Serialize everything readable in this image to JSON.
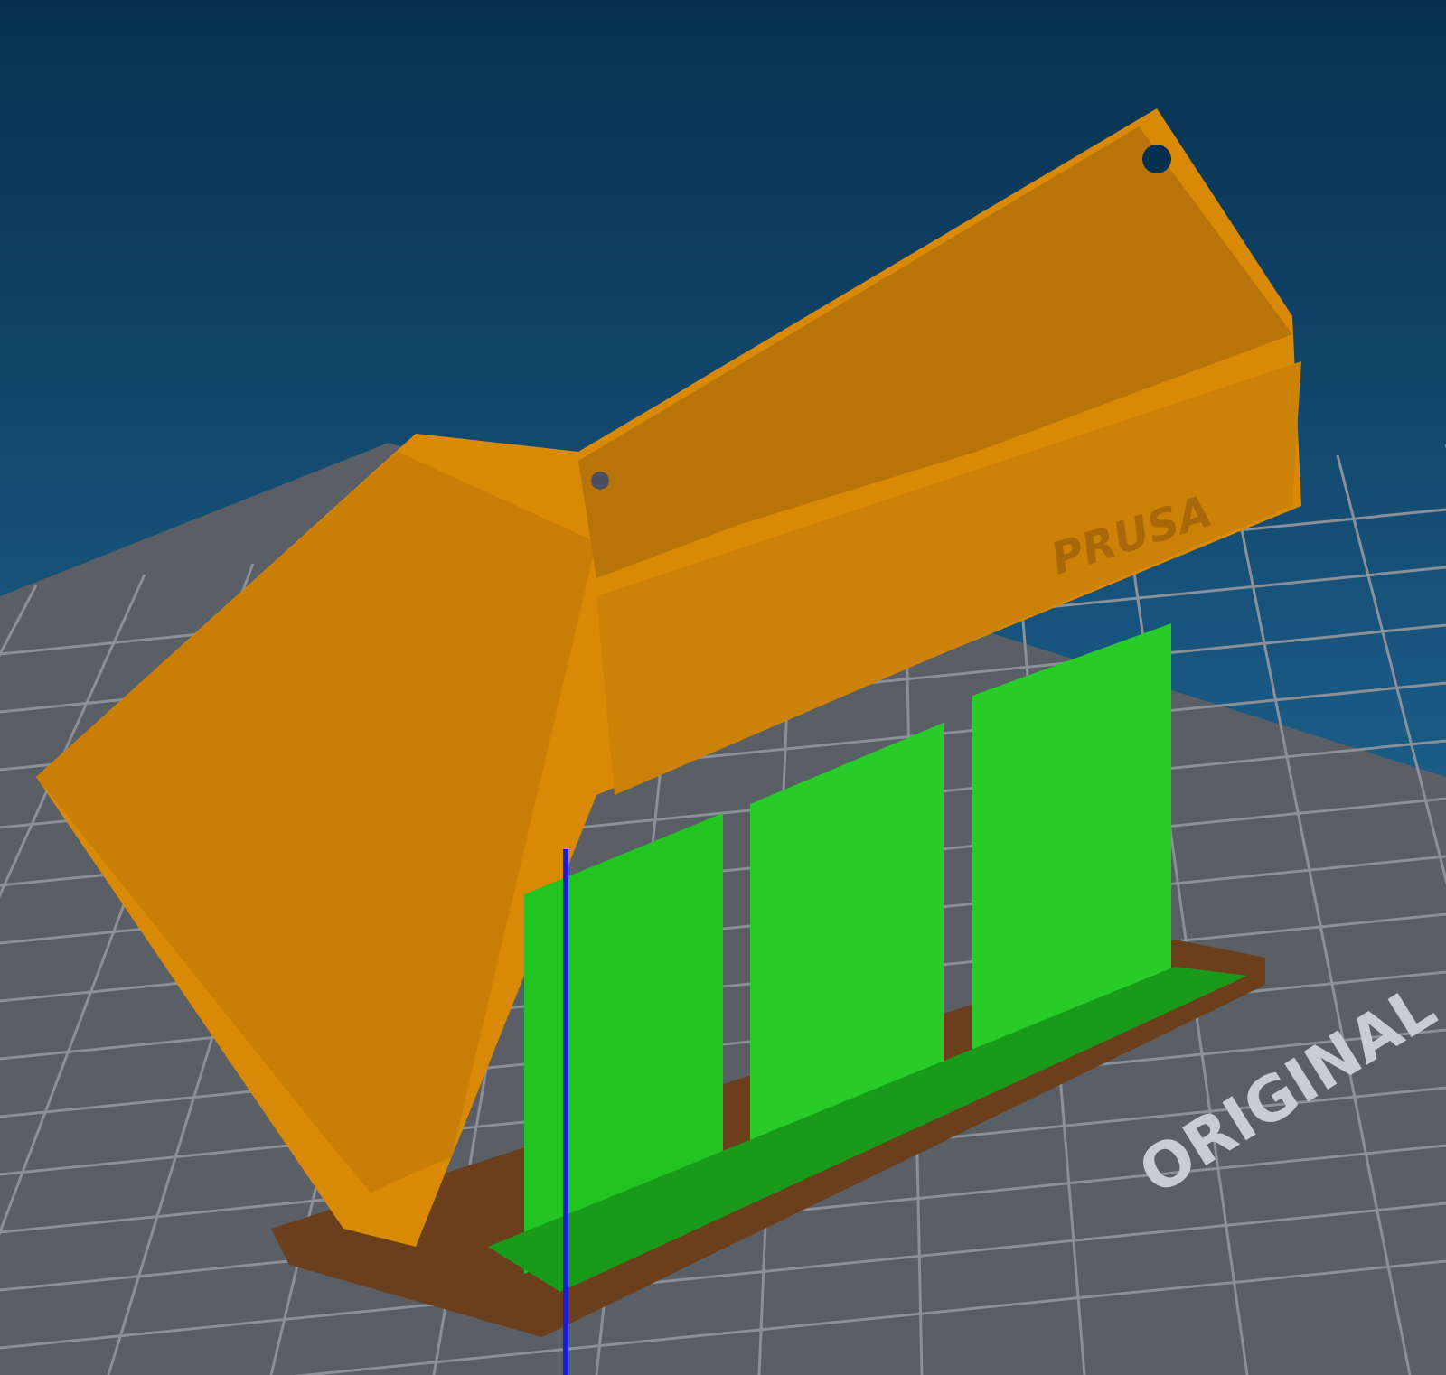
{
  "viewport": {
    "bed_label": "ORIGINAL",
    "model_text": "PRUSA"
  }
}
